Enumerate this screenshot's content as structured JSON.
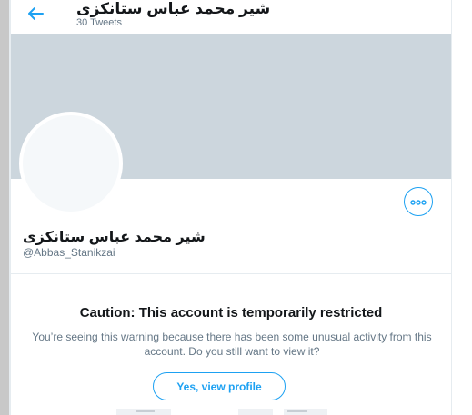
{
  "header": {
    "title": "شیر محمد عباس ستانکزی",
    "tweet_count": "30 Tweets"
  },
  "profile": {
    "name": "شیر محمد عباس ستانکزی",
    "handle": "@Abbas_Stanikzai"
  },
  "warning": {
    "title": "Caution: This account is temporarily restricted",
    "line1": "You’re seeing this warning because there has been some unusual activity from this",
    "line2": "account. Do you still want to view it?",
    "button_label": "Yes, view profile"
  },
  "colors": {
    "accent": "#1da1f2",
    "banner": "#ccd6dd",
    "secondary_text": "#657786"
  },
  "icons": {
    "back": "back-arrow-icon",
    "more": "more-dots-icon"
  }
}
